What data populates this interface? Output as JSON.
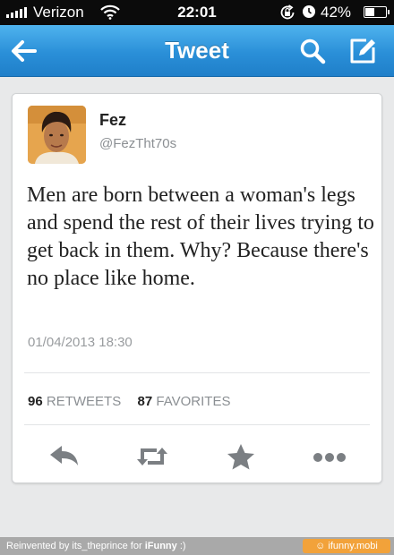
{
  "status_bar": {
    "carrier": "Verizon",
    "time": "22:01",
    "battery_percent": "42%",
    "battery_level": 0.42,
    "icons": [
      "signal-icon",
      "wifi-icon",
      "rotation-lock-icon",
      "alarm-icon",
      "battery-icon"
    ]
  },
  "nav": {
    "title": "Tweet",
    "icons": [
      "back-arrow-icon",
      "search-icon",
      "compose-icon"
    ]
  },
  "tweet": {
    "display_name": "Fez",
    "screen_name": "@FezTht70s",
    "text": "Men are born between a woman's legs and spend the rest of their lives trying to get back in them. Why? Because there's no place like home.",
    "timestamp": "01/04/2013 18:30",
    "retweets_count": "96",
    "retweets_label": "RETWEETS",
    "favorites_count": "87",
    "favorites_label": "FAVORITES",
    "actions": [
      "reply-icon",
      "retweet-icon",
      "favorite-star-icon",
      "more-icon"
    ]
  },
  "watermark": {
    "prefix": "Reinvented by its_theprince for ",
    "brand": "iFunny",
    "suffix": " :)",
    "badge": "ifunny.mobi"
  },
  "colors": {
    "nav_bar": "#2a8fd8",
    "action_icon": "#7b7f83",
    "badge": "#f2a23a"
  }
}
